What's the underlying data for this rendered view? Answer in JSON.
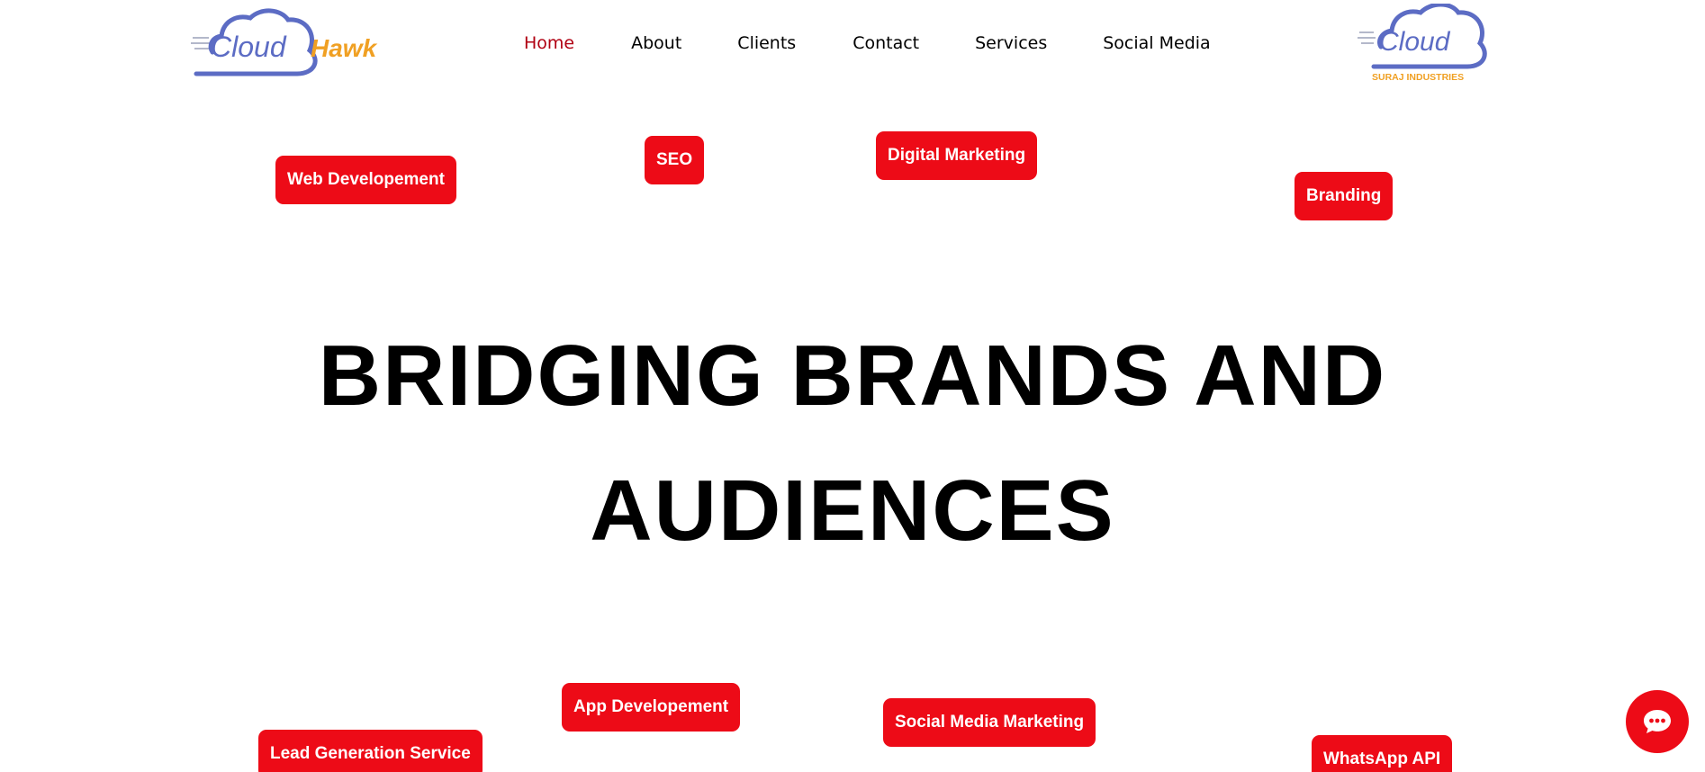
{
  "header": {
    "logo_left": {
      "cloud_text": "Cloud",
      "hawk_text": "Hawk"
    },
    "logo_right": {
      "cloud_text": "Cloud",
      "sub_text": "SURAJ INDUSTRIES"
    },
    "nav": [
      {
        "label": "Home",
        "active": true
      },
      {
        "label": "About",
        "active": false
      },
      {
        "label": "Clients",
        "active": false
      },
      {
        "label": "Contact",
        "active": false
      },
      {
        "label": "Services",
        "active": false
      },
      {
        "label": "Social Media",
        "active": false
      }
    ]
  },
  "hero": {
    "line1": "BRIDGING BRANDS AND",
    "line2": "AUDIENCES"
  },
  "tags": {
    "web_development": "Web Developement",
    "seo": "SEO",
    "digital_marketing": "Digital Marketing",
    "branding": "Branding",
    "app_development": "App Developement",
    "social_media_marketing": "Social Media Marketing",
    "lead_generation": "Lead Generation Service",
    "whatsapp_api": "WhatsApp API"
  },
  "chat": {
    "icon": "chat-bubble-icon"
  },
  "colors": {
    "accent_red": "#ed0b17",
    "nav_active": "#b00012",
    "logo_blue": "#5c6cc4",
    "logo_orange": "#f0a023"
  }
}
